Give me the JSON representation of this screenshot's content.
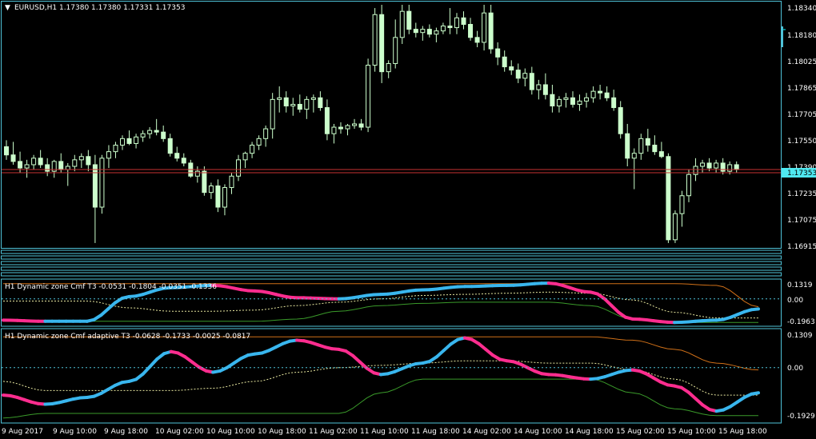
{
  "window": {
    "symbol_title": "EURUSD,H1  1.17380 1.17380 1.17331 1.17353",
    "current_price": "1.17353",
    "price_scale": [
      "1.18340",
      "1.18180",
      "1.18025",
      "1.17865",
      "1.17705",
      "1.17550",
      "1.17390",
      "1.17235",
      "1.17075",
      "1.16915"
    ]
  },
  "indicator1": {
    "title": "H1  Dynamic zone Cmf T3  -0.0531 -0.1804 -0.0351 -0.1336",
    "scale": [
      "0.1319",
      "0.00",
      "-0.1963"
    ]
  },
  "indicator2": {
    "title": "H1  Dynamic zone Cmf adaptive T3 -0.0628 -0.1733 -0.0025 -0.0817",
    "scale": [
      "0.1309",
      "0.00",
      "-0.1929"
    ]
  },
  "time_axis": [
    "9 Aug 2017",
    "9 Aug 10:00",
    "9 Aug 18:00",
    "10 Aug 02:00",
    "10 Aug 10:00",
    "10 Aug 18:00",
    "11 Aug 02:00",
    "11 Aug 10:00",
    "11 Aug 18:00",
    "14 Aug 02:00",
    "14 Aug 10:00",
    "14 Aug 18:00",
    "15 Aug 02:00",
    "15 Aug 10:00",
    "15 Aug 18:00"
  ],
  "colors": {
    "background": "#000000",
    "frame": "#4fc3d9",
    "candle": "#ccffcc",
    "bid_line": "#c83232",
    "cmf_up": "#39b6ee",
    "cmf_down": "#ff2d8f",
    "zone_upper": "#d07018",
    "zone_lower": "#3a9a2a",
    "zone_mid": "#e8e8a0",
    "scale_text": "#ffffff"
  },
  "chart_data": [
    {
      "type": "candlestick",
      "title": "EURUSD,H1",
      "ylim": [
        1.1688,
        1.1836
      ],
      "candles": [
        [
          1.1749,
          1.1753,
          1.1741,
          1.1744
        ],
        [
          1.1744,
          1.1752,
          1.1738,
          1.174
        ],
        [
          1.174,
          1.1746,
          1.1733,
          1.1736
        ],
        [
          1.1736,
          1.1741,
          1.173,
          1.1738
        ],
        [
          1.1738,
          1.1744,
          1.1735,
          1.1742
        ],
        [
          1.1742,
          1.1747,
          1.1736,
          1.1738
        ],
        [
          1.1738,
          1.1742,
          1.1731,
          1.1734
        ],
        [
          1.1734,
          1.1741,
          1.173,
          1.174
        ],
        [
          1.174,
          1.1745,
          1.1733,
          1.1735
        ],
        [
          1.1735,
          1.1739,
          1.1725,
          1.1737
        ],
        [
          1.1737,
          1.1744,
          1.1734,
          1.1741
        ],
        [
          1.1741,
          1.1745,
          1.1736,
          1.1743
        ],
        [
          1.1743,
          1.1747,
          1.1734,
          1.1738
        ],
        [
          1.1738,
          1.1744,
          1.169,
          1.1712
        ],
        [
          1.1712,
          1.1744,
          1.1708,
          1.1742
        ],
        [
          1.1742,
          1.175,
          1.1736,
          1.1746
        ],
        [
          1.1746,
          1.1752,
          1.1742,
          1.175
        ],
        [
          1.175,
          1.1756,
          1.1747,
          1.1754
        ],
        [
          1.1754,
          1.1759,
          1.175,
          1.1751
        ],
        [
          1.1751,
          1.1757,
          1.1748,
          1.1755
        ],
        [
          1.1755,
          1.1759,
          1.1752,
          1.1757
        ],
        [
          1.1757,
          1.1761,
          1.1754,
          1.1759
        ],
        [
          1.1759,
          1.1766,
          1.1756,
          1.1758
        ],
        [
          1.1758,
          1.1762,
          1.1752,
          1.1754
        ],
        [
          1.1754,
          1.1757,
          1.1743,
          1.1745
        ],
        [
          1.1745,
          1.1749,
          1.174,
          1.1742
        ],
        [
          1.1742,
          1.1745,
          1.1737,
          1.1739
        ],
        [
          1.1739,
          1.1741,
          1.173,
          1.1731
        ],
        [
          1.1731,
          1.1737,
          1.1727,
          1.1734
        ],
        [
          1.1734,
          1.1737,
          1.1719,
          1.1721
        ],
        [
          1.1721,
          1.1727,
          1.1717,
          1.1725
        ],
        [
          1.1725,
          1.1729,
          1.1709,
          1.1712
        ],
        [
          1.1712,
          1.1726,
          1.1707,
          1.1724
        ],
        [
          1.1724,
          1.1733,
          1.172,
          1.1731
        ],
        [
          1.1731,
          1.1744,
          1.1728,
          1.1741
        ],
        [
          1.1741,
          1.1746,
          1.1736,
          1.1745
        ],
        [
          1.1745,
          1.1752,
          1.1742,
          1.175
        ],
        [
          1.175,
          1.1756,
          1.1747,
          1.1754
        ],
        [
          1.1754,
          1.1762,
          1.1749,
          1.176
        ],
        [
          1.176,
          1.1782,
          1.1754,
          1.1778
        ],
        [
          1.1778,
          1.1786,
          1.177,
          1.1779
        ],
        [
          1.1779,
          1.1783,
          1.177,
          1.1774
        ],
        [
          1.1774,
          1.1779,
          1.1768,
          1.1775
        ],
        [
          1.1775,
          1.1781,
          1.177,
          1.1772
        ],
        [
          1.1772,
          1.178,
          1.1766,
          1.1778
        ],
        [
          1.1778,
          1.1781,
          1.177,
          1.1779
        ],
        [
          1.1779,
          1.1783,
          1.1771,
          1.1773
        ],
        [
          1.1773,
          1.1778,
          1.1753,
          1.1757
        ],
        [
          1.1757,
          1.1763,
          1.1751,
          1.1761
        ],
        [
          1.1761,
          1.1764,
          1.1757,
          1.176
        ],
        [
          1.176,
          1.1763,
          1.1756,
          1.1762
        ],
        [
          1.1762,
          1.1766,
          1.176,
          1.1763
        ],
        [
          1.1763,
          1.1766,
          1.1759,
          1.1761
        ],
        [
          1.1761,
          1.1803,
          1.1758,
          1.1799
        ],
        [
          1.1799,
          1.1834,
          1.1795,
          1.183
        ],
        [
          1.183,
          1.1836,
          1.1788,
          1.1795
        ],
        [
          1.1795,
          1.1802,
          1.1791,
          1.18
        ],
        [
          1.18,
          1.1827,
          1.1797,
          1.1816
        ],
        [
          1.1816,
          1.1836,
          1.1812,
          1.1832
        ],
        [
          1.1832,
          1.1836,
          1.1818,
          1.1821
        ],
        [
          1.1821,
          1.1825,
          1.1816,
          1.1819
        ],
        [
          1.1819,
          1.1823,
          1.1814,
          1.1821
        ],
        [
          1.1821,
          1.1824,
          1.1816,
          1.1818
        ],
        [
          1.1818,
          1.1822,
          1.1813,
          1.182
        ],
        [
          1.182,
          1.1825,
          1.1818,
          1.1823
        ],
        [
          1.1823,
          1.1834,
          1.1818,
          1.1822
        ],
        [
          1.1822,
          1.1831,
          1.1818,
          1.1828
        ],
        [
          1.1828,
          1.1832,
          1.1821,
          1.1824
        ],
        [
          1.1824,
          1.1828,
          1.1814,
          1.1816
        ],
        [
          1.1816,
          1.182,
          1.181,
          1.1813
        ],
        [
          1.1813,
          1.1836,
          1.1808,
          1.1831
        ],
        [
          1.1831,
          1.1836,
          1.1806,
          1.1809
        ],
        [
          1.1809,
          1.1813,
          1.1799,
          1.1804
        ],
        [
          1.1804,
          1.1808,
          1.1795,
          1.1798
        ],
        [
          1.1798,
          1.1802,
          1.1793,
          1.1796
        ],
        [
          1.1796,
          1.18,
          1.1788,
          1.1791
        ],
        [
          1.1791,
          1.1797,
          1.1786,
          1.1794
        ],
        [
          1.1794,
          1.1798,
          1.1781,
          1.1784
        ],
        [
          1.1784,
          1.179,
          1.1778,
          1.1787
        ],
        [
          1.1787,
          1.1794,
          1.1778,
          1.1781
        ],
        [
          1.1781,
          1.1787,
          1.177,
          1.1774
        ],
        [
          1.1774,
          1.178,
          1.177,
          1.1778
        ],
        [
          1.1778,
          1.1782,
          1.1773,
          1.1779
        ],
        [
          1.1779,
          1.1783,
          1.1773,
          1.1775
        ],
        [
          1.1775,
          1.1781,
          1.1771,
          1.1777
        ],
        [
          1.1777,
          1.1782,
          1.1773,
          1.1779
        ],
        [
          1.1779,
          1.1786,
          1.1776,
          1.1783
        ],
        [
          1.1783,
          1.1787,
          1.1778,
          1.1782
        ],
        [
          1.1782,
          1.1786,
          1.1777,
          1.1779
        ],
        [
          1.1779,
          1.1784,
          1.1771,
          1.1773
        ],
        [
          1.1773,
          1.1777,
          1.1754,
          1.1757
        ],
        [
          1.1757,
          1.1763,
          1.1737,
          1.1742
        ],
        [
          1.1742,
          1.1748,
          1.1723,
          1.1745
        ],
        [
          1.1745,
          1.1757,
          1.1741,
          1.1754
        ],
        [
          1.1754,
          1.176,
          1.1746,
          1.175
        ],
        [
          1.175,
          1.1756,
          1.1744,
          1.1746
        ],
        [
          1.1746,
          1.1752,
          1.1742,
          1.1743
        ],
        [
          1.1743,
          1.1745,
          1.169,
          1.1692
        ],
        [
          1.1692,
          1.171,
          1.169,
          1.1708
        ],
        [
          1.1708,
          1.1722,
          1.17,
          1.1719
        ],
        [
          1.1719,
          1.1735,
          1.1715,
          1.1732
        ],
        [
          1.1732,
          1.1742,
          1.1728,
          1.1737
        ],
        [
          1.1737,
          1.1741,
          1.1733,
          1.1739
        ],
        [
          1.1739,
          1.1742,
          1.1734,
          1.1736
        ],
        [
          1.1736,
          1.1741,
          1.1733,
          1.1739
        ],
        [
          1.1739,
          1.1742,
          1.1732,
          1.1734
        ],
        [
          1.1734,
          1.174,
          1.1732,
          1.1738
        ],
        [
          1.1738,
          1.174,
          1.1733,
          1.1735
        ]
      ]
    },
    {
      "type": "line",
      "title": "H1  Dynamic zone Cmf T3",
      "ylim": [
        -0.23,
        0.155
      ],
      "x": [
        0,
        6,
        12,
        18,
        24,
        30,
        36,
        42,
        48,
        54,
        60,
        66,
        72,
        78,
        84,
        90,
        96,
        102,
        108
      ],
      "series": [
        {
          "values": [
            -0.19,
            -0.2,
            -0.2,
            0.02,
            0.1,
            0.12,
            0.07,
            0.01,
            0.0,
            0.04,
            0.08,
            0.11,
            0.12,
            0.14,
            0.06,
            -0.18,
            -0.21,
            -0.19,
            -0.09
          ]
        },
        {
          "values": [
            0.135,
            0.135,
            0.135,
            0.135,
            0.135,
            0.135,
            0.135,
            0.135,
            0.135,
            0.135,
            0.135,
            0.135,
            0.135,
            0.135,
            0.135,
            0.135,
            0.135,
            0.12,
            -0.07
          ]
        },
        {
          "values": [
            -0.2,
            -0.2,
            -0.2,
            -0.2,
            -0.2,
            -0.2,
            -0.2,
            -0.18,
            -0.11,
            -0.06,
            -0.04,
            -0.03,
            -0.03,
            -0.03,
            -0.06,
            -0.18,
            -0.21,
            -0.21,
            -0.21
          ]
        },
        {
          "values": [
            -0.02,
            -0.02,
            -0.02,
            -0.08,
            -0.11,
            -0.11,
            -0.1,
            -0.06,
            -0.03,
            0.0,
            0.03,
            0.04,
            0.05,
            0.06,
            0.05,
            -0.01,
            -0.12,
            -0.17,
            -0.17
          ]
        }
      ]
    },
    {
      "type": "line",
      "title": "H1  Dynamic zone Cmf adaptive T3",
      "ylim": [
        -0.235,
        0.16
      ],
      "x": [
        0,
        6,
        12,
        18,
        24,
        30,
        36,
        42,
        48,
        54,
        60,
        66,
        72,
        78,
        84,
        90,
        96,
        102,
        108
      ],
      "series": [
        {
          "values": [
            -0.12,
            -0.16,
            -0.13,
            -0.06,
            0.07,
            -0.02,
            0.06,
            0.12,
            0.08,
            -0.03,
            0.02,
            0.13,
            0.03,
            -0.03,
            -0.05,
            -0.01,
            -0.08,
            -0.19,
            -0.11
          ]
        },
        {
          "values": [
            0.135,
            0.135,
            0.135,
            0.135,
            0.135,
            0.135,
            0.135,
            0.135,
            0.135,
            0.135,
            0.135,
            0.135,
            0.135,
            0.135,
            0.135,
            0.12,
            0.08,
            0.02,
            -0.01
          ]
        },
        {
          "values": [
            -0.22,
            -0.2,
            -0.2,
            -0.2,
            -0.2,
            -0.2,
            -0.2,
            -0.2,
            -0.2,
            -0.11,
            -0.05,
            -0.05,
            -0.05,
            -0.05,
            -0.05,
            -0.11,
            -0.18,
            -0.21,
            -0.21
          ]
        },
        {
          "values": [
            -0.06,
            -0.1,
            -0.1,
            -0.1,
            -0.1,
            -0.09,
            -0.06,
            -0.02,
            0.0,
            0.01,
            0.02,
            0.03,
            0.03,
            0.02,
            0.02,
            -0.01,
            -0.05,
            -0.12,
            -0.12
          ]
        }
      ]
    }
  ]
}
